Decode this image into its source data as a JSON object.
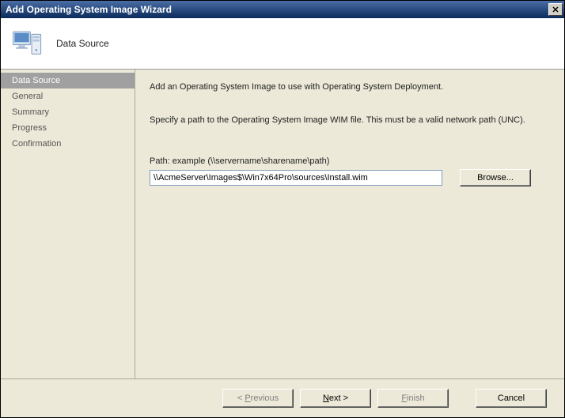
{
  "window": {
    "title": "Add Operating System Image Wizard"
  },
  "header": {
    "title": "Data Source"
  },
  "sidebar": {
    "items": [
      {
        "label": "Data Source",
        "active": true
      },
      {
        "label": "General",
        "active": false
      },
      {
        "label": "Summary",
        "active": false
      },
      {
        "label": "Progress",
        "active": false
      },
      {
        "label": "Confirmation",
        "active": false
      }
    ]
  },
  "content": {
    "intro": "Add an Operating System Image to use with Operating System Deployment.",
    "instruction": "Specify a path to the Operating System Image WIM file. This must be a valid network path (UNC).",
    "path_label": "Path: example (\\\\servername\\sharename\\path)",
    "path_value": "\\\\AcmeServer\\Images$\\Win7x64Pro\\sources\\Install.wim",
    "browse_label": "Browse..."
  },
  "footer": {
    "previous": "< Previous",
    "next": "Next >",
    "finish": "Finish",
    "cancel": "Cancel"
  }
}
